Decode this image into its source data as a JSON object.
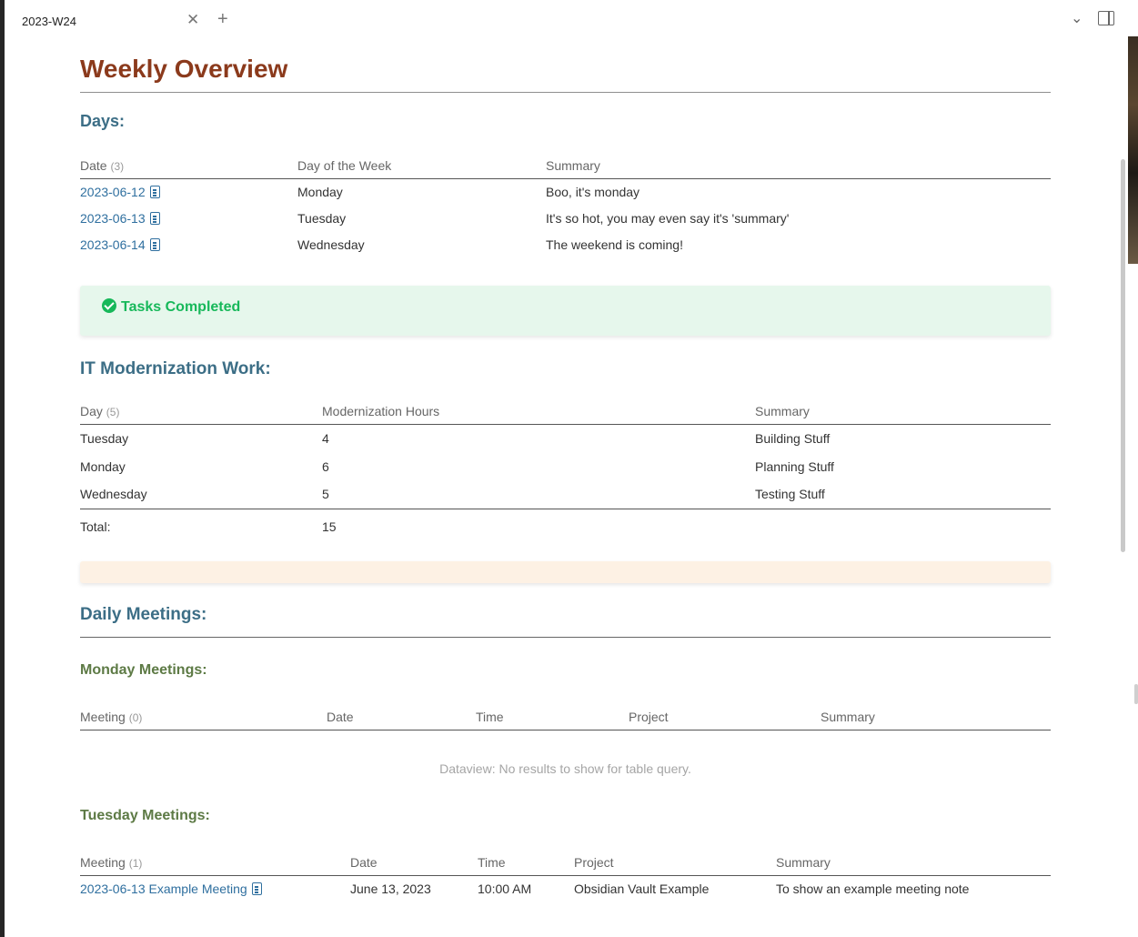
{
  "tab": {
    "title": "2023-W24"
  },
  "page": {
    "title": "Weekly Overview",
    "days_heading": "Days:",
    "days_table": {
      "columns": [
        "Date",
        "Day of the Week",
        "Summary"
      ],
      "count": "(3)",
      "rows": [
        {
          "date": "2023-06-12",
          "day": "Monday",
          "summary": "Boo, it's monday"
        },
        {
          "date": "2023-06-13",
          "day": "Tuesday",
          "summary": "It's so hot, you may even say it's 'summary'"
        },
        {
          "date": "2023-06-14",
          "day": "Wednesday",
          "summary": "The weekend is coming!"
        }
      ]
    },
    "tasks_callout": {
      "title": "Tasks Completed"
    },
    "it_heading": "IT Modernization Work:",
    "it_table": {
      "columns": [
        "Day",
        "Modernization Hours",
        "Summary"
      ],
      "count": "(5)",
      "rows": [
        {
          "day": "Tuesday",
          "hours": "4",
          "summary": "Building Stuff"
        },
        {
          "day": "Monday",
          "hours": "6",
          "summary": "Planning Stuff"
        },
        {
          "day": "Wednesday",
          "hours": "5",
          "summary": "Testing Stuff"
        }
      ],
      "total_label": "Total:",
      "total_value": "15"
    },
    "daily_meetings_heading": "Daily Meetings:",
    "monday": {
      "heading": "Monday Meetings:",
      "columns": [
        "Meeting",
        "Date",
        "Time",
        "Project",
        "Summary"
      ],
      "count": "(0)",
      "no_results": "Dataview: No results to show for table query."
    },
    "tuesday": {
      "heading": "Tuesday Meetings:",
      "columns": [
        "Meeting",
        "Date",
        "Time",
        "Project",
        "Summary"
      ],
      "count": "(1)",
      "rows": [
        {
          "meeting": "2023-06-13 Example Meeting",
          "date": "June 13, 2023",
          "time": "10:00 AM",
          "project": "Obsidian Vault Example",
          "summary": "To show an example meeting note"
        }
      ]
    }
  },
  "icons": {
    "tab_close": "close-icon",
    "new_tab": "plus-icon",
    "tab_list": "chevron-down-icon",
    "sidebar": "sidebar-toggle-icon",
    "note": "note-icon",
    "callout_check": "check-circle-icon"
  },
  "colors": {
    "title": "#8b3a1c",
    "heading": "#3c6e86",
    "subheading": "#5d7a45",
    "link": "#2f6f9f",
    "tasks_callout_bg": "#e6f7ec",
    "tasks_callout_fg": "#17b85a",
    "empty_callout_bg": "#fdf1e4"
  }
}
